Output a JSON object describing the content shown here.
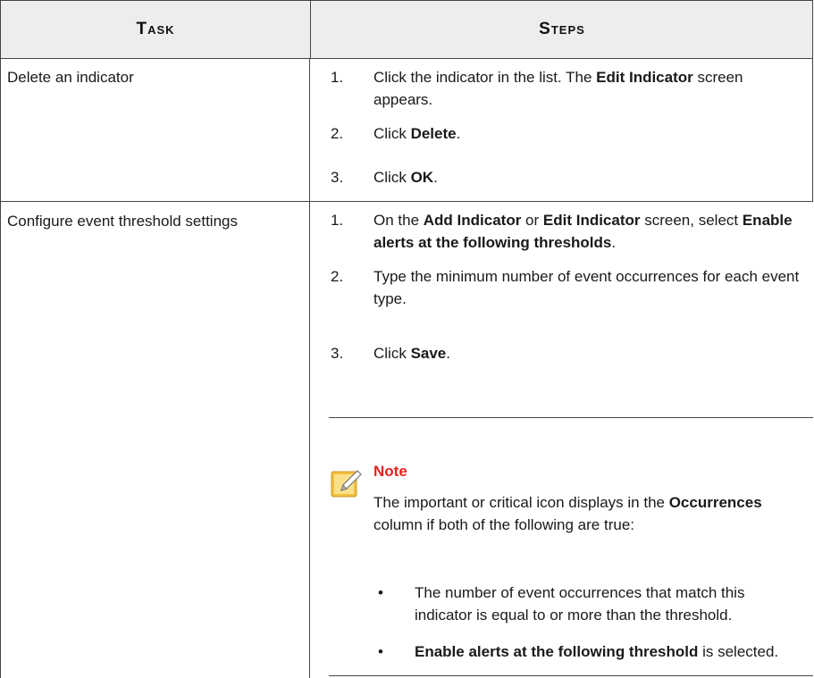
{
  "headers": {
    "task": "Task",
    "steps": "Steps"
  },
  "rows": [
    {
      "task": "Delete an indicator",
      "steps": [
        {
          "num": "1.",
          "parts": [
            "Click the indicator in the list. The ",
            "Edit Indicator",
            " screen appears."
          ]
        },
        {
          "num": "2.",
          "parts": [
            "Click ",
            "Delete",
            "."
          ]
        },
        {
          "num": "3.",
          "parts": [
            "Click ",
            "OK",
            "."
          ]
        }
      ]
    },
    {
      "task": "Configure event threshold settings",
      "steps": [
        {
          "num": "1.",
          "parts": [
            "On the ",
            "Add Indicator",
            " or ",
            "Edit Indicator",
            " screen, select ",
            "Enable alerts at the following thresholds",
            "."
          ]
        },
        {
          "num": "2.",
          "parts": [
            "Type the minimum number of event occurrences for each event type."
          ]
        },
        {
          "num": "3.",
          "parts": [
            "Click ",
            "Save",
            "."
          ]
        }
      ]
    }
  ],
  "note": {
    "icon": "note-pencil-icon",
    "title": "Note",
    "body_parts": [
      "The important or critical icon displays in the ",
      "Occurrences",
      " column if both of the following are true:"
    ],
    "bullets": [
      {
        "mark": "•",
        "parts": [
          "The number of event occurrences that match this indicator is equal to or more than the threshold."
        ]
      },
      {
        "mark": "•",
        "parts": [
          "Enable alerts at the following threshold",
          " is selected."
        ]
      }
    ]
  },
  "colors": {
    "header_bg": "#ededed",
    "note_title": "#e2231a",
    "note_icon": "#f2c13c"
  }
}
